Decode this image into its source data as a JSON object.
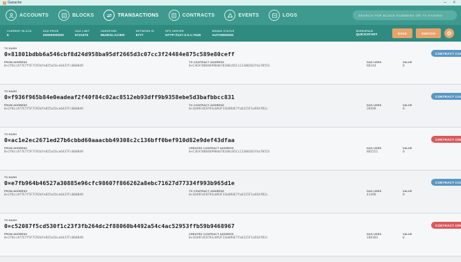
{
  "window": {
    "title": "Ganache",
    "min": "–",
    "close": "×"
  },
  "nav": {
    "items": [
      {
        "label": "ACCOUNTS",
        "icon": "account-icon",
        "active": false
      },
      {
        "label": "BLOCKS",
        "icon": "blocks-icon",
        "active": false
      },
      {
        "label": "TRANSACTIONS",
        "icon": "transactions-icon",
        "active": true
      },
      {
        "label": "CONTRACTS",
        "icon": "contracts-icon",
        "active": false
      },
      {
        "label": "EVENTS",
        "icon": "events-icon",
        "active": false
      },
      {
        "label": "LOGS",
        "icon": "logs-icon",
        "active": false
      }
    ],
    "search_placeholder": "SEARCH FOR BLOCK NUMBERS OR TX HASHES"
  },
  "stats": [
    {
      "label": "CURRENT BLOCK",
      "value": "5"
    },
    {
      "label": "GAS PRICE",
      "value": "20000000000"
    },
    {
      "label": "GAS LIMIT",
      "value": "6721975"
    },
    {
      "label": "HARDFORK",
      "value": "MUIRGLACIER"
    },
    {
      "label": "NETWORK ID",
      "value": "5777"
    },
    {
      "label": "RPC SERVER",
      "value": "HTTP://127.0.0.1:7545"
    },
    {
      "label": "MINING STATUS",
      "value": "AUTOMINING"
    }
  ],
  "workspace": {
    "label": "WORKSPACE",
    "value": "QUICKSTART"
  },
  "buttons": {
    "save": "SAVE",
    "switch": "SWITCH"
  },
  "colors": {
    "nav": "#3e9a8f",
    "stats": "#2f8b80",
    "accent": "#e8a36b",
    "call": "#5a97c4",
    "create": "#d9595c"
  },
  "labels": {
    "tx_hash": "TX HASH",
    "from": "FROM ADDRESS",
    "to": "TO CONTRACT ADDRESS",
    "created": "CREATED CONTRACT ADDRESS",
    "gas": "GAS USED",
    "value": "VALUE"
  },
  "transactions": [
    {
      "hash": "0×81801bdbb6a546cbf8d24d958ba95df2665d3c07cc3f24484e875c589e80ceff",
      "from": "0×2f8cc4f7E7f5F7C92bfe825aC6ce6437Fc0688d9",
      "to_label": "TO CONTRACT ADDRESS",
      "to": "0×C3EA788846990db78188c85Cc21300203f4a78553",
      "gas": "88244",
      "value": "0",
      "badge": "CONTRACT CALL",
      "type": "call"
    },
    {
      "hash": "0×f936f965b84e0eadeaf2f40f84c02ac8512eb93dff9b9358ebe5d3bafbbcc831",
      "from": "0×2f8cc4f7E7f5F7C92bfe825aC6ce6437Fc0688d9",
      "to_label": "TO CONTRACT ADDRESS",
      "to": "0×1D49FdC8793c092F31b894E7fa6115F1a93AfD2c",
      "gas": "28498",
      "value": "0",
      "badge": "CONTRACT CALL",
      "type": "call"
    },
    {
      "hash": "0×ac1e2ec2671ed27b6cbbd60aaacbb49308c2c136bff0bef910d82e9def43dfaa",
      "from": "0×2f8cc4f7E7f5F7C92bfe825aC6ce6437Fc0688d9",
      "to_label": "CREATED CONTRACT ADDRESS",
      "to": "0×C3EA788846990db78188c85Cc21300203f4a78553",
      "gas": "882551",
      "value": "0",
      "badge": "CONTRACT CREATION",
      "type": "create"
    },
    {
      "hash": "0×e7fb964b46527a30885e96cfc98607f866262a8ebc71627d77334f993b965d1e",
      "from": "0×2f8cc4f7E7f5F7C92bfe825aC6ce6437Fc0688d9",
      "to_label": "TO CONTRACT ADDRESS",
      "to": "0×1D49FdC8793c092F31b894E7fa6115F1a93AfD2c",
      "gas": "41498",
      "value": "0",
      "badge": "CONTRACT CALL",
      "type": "call"
    },
    {
      "hash": "0×c52087f5cd530f1c23f3fb264dc2f88060b4492a54c4ac52953ffb59b9468967",
      "from": "0×2f8cc4f7E7f5F7C92bfe825aC6ce6437Fc0688d9",
      "to_label": "CREATED CONTRACT ADDRESS",
      "to": "0×1D49FdC8793c092F31b894E7fa6115F1a93AfD2c",
      "gas": "188303",
      "value": "0",
      "badge": "CONTRACT CREATION",
      "type": "create"
    }
  ]
}
